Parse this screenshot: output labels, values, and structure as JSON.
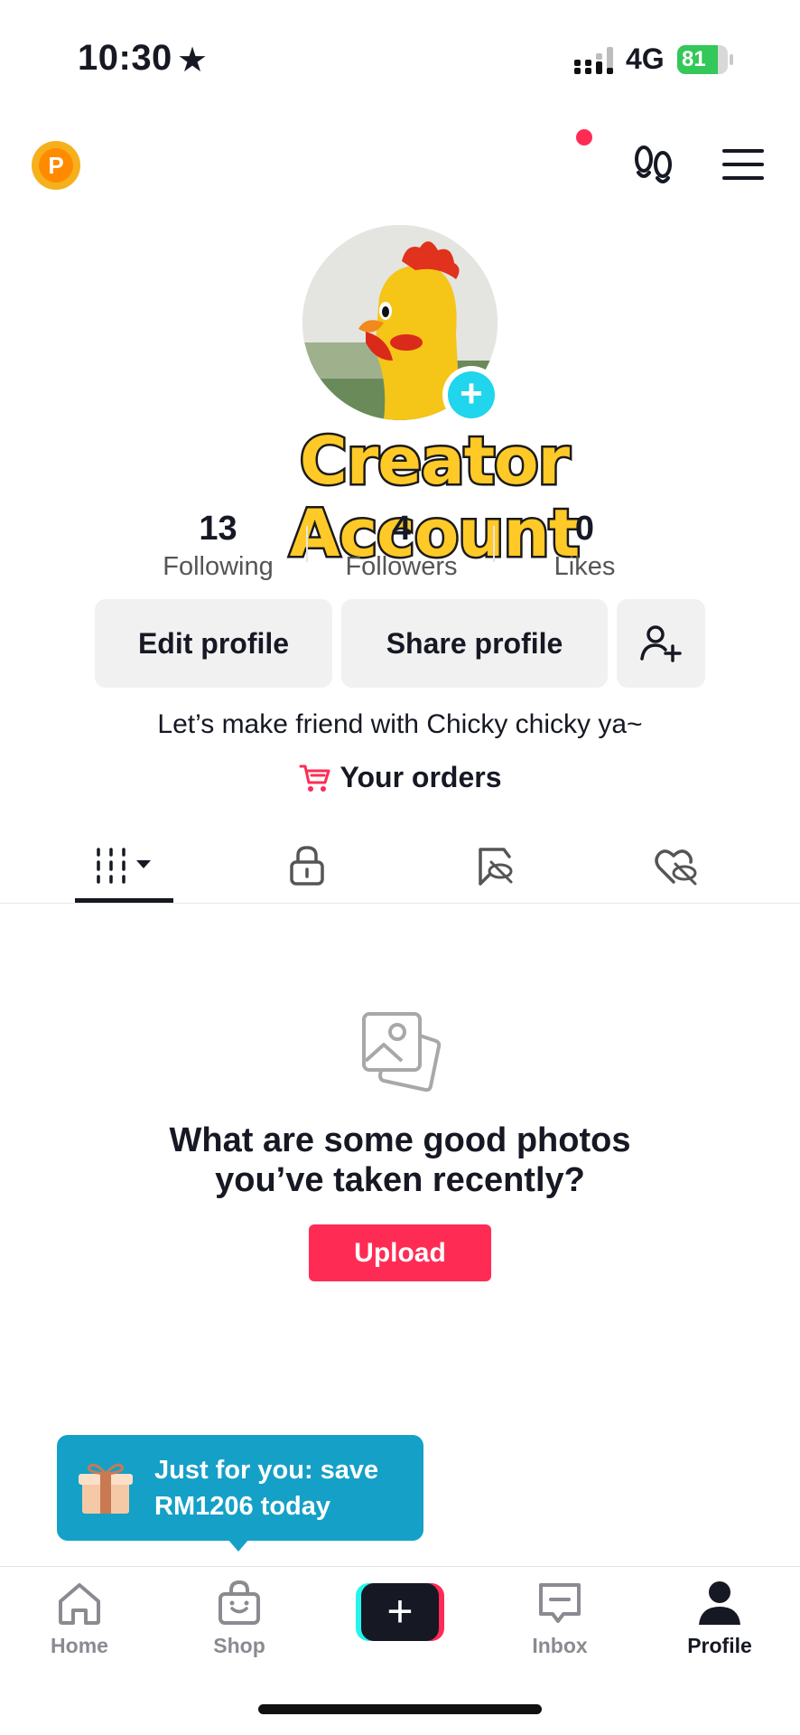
{
  "status_bar": {
    "time": "10:30",
    "network": "4G",
    "battery": "81",
    "battery_level": 0.81
  },
  "header": {
    "coin_label": "P"
  },
  "profile": {
    "banner": "Creator Account",
    "stats": [
      {
        "value": "13",
        "label": "Following"
      },
      {
        "value": "4",
        "label": "Followers"
      },
      {
        "value": "0",
        "label": "Likes"
      }
    ],
    "edit_label": "Edit profile",
    "share_label": "Share profile",
    "bio": "Let’s make friend with Chicky chicky ya~",
    "orders_label": "Your orders"
  },
  "empty_state": {
    "title_line1": "What are some good photos",
    "title_line2": "you’ve taken recently?",
    "upload_label": "Upload"
  },
  "promo": {
    "line1": "Just for you: save",
    "line2": "RM1206 today"
  },
  "bottom_nav": {
    "home": "Home",
    "shop": "Shop",
    "inbox": "Inbox",
    "profile": "Profile"
  },
  "colors": {
    "accent": "#fe2c55",
    "teal": "#25f4ee",
    "promo": "#15a0c7"
  }
}
